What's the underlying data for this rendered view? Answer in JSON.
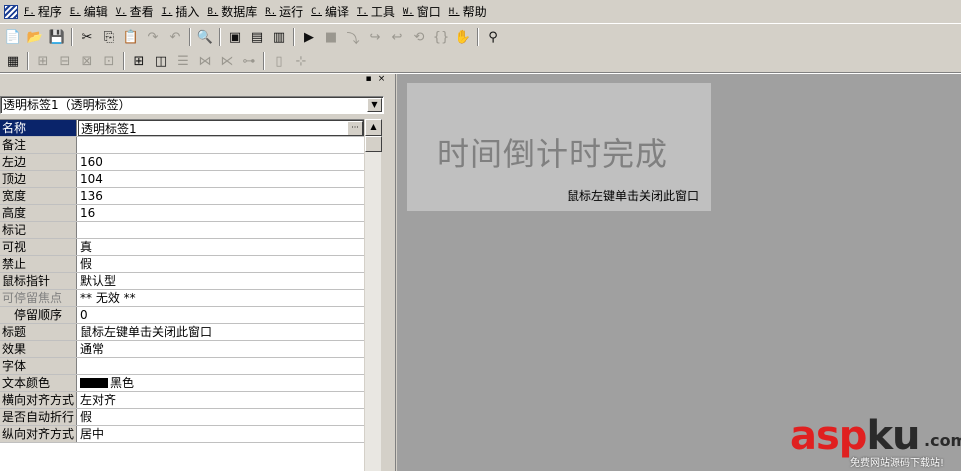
{
  "menubar": {
    "items": [
      {
        "key": "F.",
        "label": "程序"
      },
      {
        "key": "E.",
        "label": "编辑"
      },
      {
        "key": "V.",
        "label": "查看"
      },
      {
        "key": "I.",
        "label": "插入"
      },
      {
        "key": "B.",
        "label": "数据库"
      },
      {
        "key": "R.",
        "label": "运行"
      },
      {
        "key": "C.",
        "label": "编译"
      },
      {
        "key": "T.",
        "label": "工具"
      },
      {
        "key": "W.",
        "label": "窗口"
      },
      {
        "key": "H.",
        "label": "帮助"
      }
    ]
  },
  "toolbar": {
    "icons": {
      "new": "📄",
      "open": "📂",
      "save": "💾",
      "cut": "✂",
      "copy": "⎘",
      "paste": "📋",
      "redo": "↷",
      "undo": "↶",
      "find": "🔍",
      "layout1": "▣",
      "layout2": "▤",
      "layout3": "▥",
      "run": "▶",
      "stop": "■",
      "step1": "⤵",
      "step2": "↪",
      "step3": "↩",
      "step4": "⟲",
      "step5": "{}",
      "hand": "✋",
      "binoculars": "⚲"
    },
    "align_icons": [
      "▦",
      "⊞",
      "⊟",
      "⊠",
      "⊡",
      "⊞",
      "◫",
      "☰",
      "⋈",
      "⋉",
      "⊶",
      "▯",
      "⊹"
    ]
  },
  "property_panel": {
    "caption_buttons": {
      "pin": "▪",
      "close": "×"
    },
    "object_selector": "透明标签1（透明标签）",
    "rows": [
      {
        "name": "名称",
        "value": "透明标签1"
      },
      {
        "name": "备注",
        "value": ""
      },
      {
        "name": "左边",
        "value": "160"
      },
      {
        "name": "顶边",
        "value": "104"
      },
      {
        "name": "宽度",
        "value": "136"
      },
      {
        "name": "高度",
        "value": "16"
      },
      {
        "name": "标记",
        "value": ""
      },
      {
        "name": "可视",
        "value": "真"
      },
      {
        "name": "禁止",
        "value": "假"
      },
      {
        "name": "鼠标指针",
        "value": "默认型"
      },
      {
        "name": "可停留焦点",
        "value": "** 无效 **"
      },
      {
        "name": "停留顺序",
        "value": "0"
      },
      {
        "name": "标题",
        "value": "鼠标左键单击关闭此窗口"
      },
      {
        "name": "效果",
        "value": "通常"
      },
      {
        "name": "字体",
        "value": ""
      },
      {
        "name": "文本颜色",
        "value": "黑色"
      },
      {
        "name": "横向对齐方式",
        "value": "左对齐"
      },
      {
        "name": "是否自动折行",
        "value": "假"
      },
      {
        "name": "纵向对齐方式",
        "value": "居中"
      }
    ],
    "ellipsis": "···",
    "dropdown_arrow": "▼",
    "scroll_up": "▲"
  },
  "design": {
    "title_text": "时间倒计时完成",
    "hint_text": "鼠标左键单击关闭此窗口"
  },
  "watermark": {
    "logo_red": "asp",
    "logo_dark": "ku",
    "com": ".com",
    "sub": "免费网站源码下载站!"
  },
  "colors": {
    "selection": "#0a246a",
    "canvas": "#a0a0a0",
    "window_face": "#d4d0c8",
    "design_window": "#c0c0c0",
    "title_text": "#808080",
    "watermark_red": "#e02020"
  }
}
